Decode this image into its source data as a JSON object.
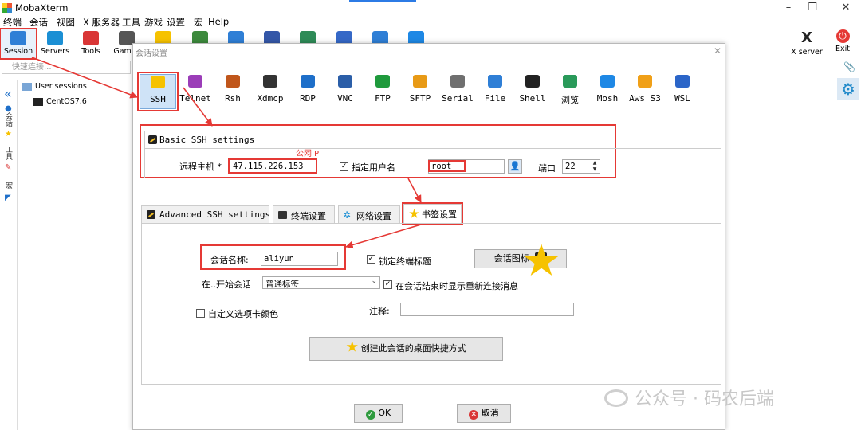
{
  "app": {
    "title": "MobaXterm",
    "window_buttons": [
      "–",
      "❐",
      "✕"
    ]
  },
  "menu": [
    "终端",
    "会话",
    "视图",
    "X 服务器",
    "工具",
    "游戏",
    "设置",
    "宏",
    "Help"
  ],
  "toolbar": {
    "items": [
      {
        "label": "Session",
        "icon": "monitor-icon",
        "color": "#2f7fd6"
      },
      {
        "label": "Servers",
        "icon": "network-icon",
        "color": "#1b8fd4"
      },
      {
        "label": "Tools",
        "icon": "tools-icon",
        "color": "#d93636"
      },
      {
        "label": "Games",
        "icon": "gamepad-icon",
        "color": "#555555"
      },
      {
        "label": "",
        "icon": "star-icon",
        "color": "#f6c200"
      },
      {
        "label": "",
        "icon": "user-monitor-icon",
        "color": "#3d8a3d"
      },
      {
        "label": "",
        "icon": "grid-icon",
        "color": "#2f7fd6"
      },
      {
        "label": "",
        "icon": "fork-icon",
        "color": "#3457a8"
      },
      {
        "label": "",
        "icon": "screen-icon",
        "color": "#2e8b57"
      },
      {
        "label": "",
        "icon": "download-icon",
        "color": "#3568c7"
      },
      {
        "label": "",
        "icon": "gears-icon",
        "color": "#2f7fd6"
      },
      {
        "label": "",
        "icon": "help-icon",
        "color": "#1e88e5"
      }
    ],
    "xserver_label": "X server",
    "exit_label": "Exit"
  },
  "quick_connect": {
    "placeholder": "快速连接..."
  },
  "sidebar": {
    "tabs": [
      "会话",
      "工具",
      "宏"
    ],
    "tree": [
      {
        "label": "User sessions"
      },
      {
        "label": "CentOS7.6"
      }
    ]
  },
  "dialog": {
    "title": "会话设置",
    "session_types": [
      "SSH",
      "Telnet",
      "Rsh",
      "Xdmcp",
      "RDP",
      "VNC",
      "FTP",
      "SFTP",
      "Serial",
      "File",
      "Shell",
      "浏览",
      "Mosh",
      "Aws S3",
      "WSL"
    ],
    "session_type_colors": [
      "#f6c200",
      "#9b3db8",
      "#c0561b",
      "#333333",
      "#1e6fc9",
      "#2b5ea8",
      "#1f9a3c",
      "#e89a16",
      "#6f6f6f",
      "#2f7fd6",
      "#222222",
      "#2a9a5a",
      "#1e88e5",
      "#f0a018",
      "#2b65c8"
    ],
    "basic_tab": {
      "label": "Basic SSH settings"
    },
    "remote_host_label": "远程主机 *",
    "remote_host_value": "47.115.226.153",
    "ip_annotation": "公网IP",
    "specify_user_label": "指定用户名",
    "specify_user_checked": true,
    "username_value": "root",
    "port_label": "端口",
    "port_value": "22",
    "adv_tabs": [
      {
        "label": "Advanced SSH settings"
      },
      {
        "label": "终端设置"
      },
      {
        "label": "网络设置"
      },
      {
        "label": "书签设置"
      }
    ],
    "bookmark": {
      "session_name_label": "会话名称:",
      "session_name_value": "aliyun",
      "lock_title_label": "锁定终端标题",
      "lock_title_checked": true,
      "session_icon_button": "会话图标",
      "start_session_label": "在..开始会话",
      "start_session_value": "普通标签",
      "show_reconnect_label": "在会话结束时显示重新连接消息",
      "show_reconnect_checked": true,
      "custom_tab_color_label": "自定义选项卡颜色",
      "custom_tab_color_checked": false,
      "comment_label": "注释:",
      "comment_value": "",
      "shortcut_button": "创建此会话的桌面快捷方式"
    },
    "ok_button": "OK",
    "cancel_button": "取消"
  },
  "watermark": "公众号 · 码农后端",
  "colors": {
    "annotation_red": "#e53935",
    "accent_blue": "#2c7be5",
    "star_yellow": "#f6c200"
  }
}
